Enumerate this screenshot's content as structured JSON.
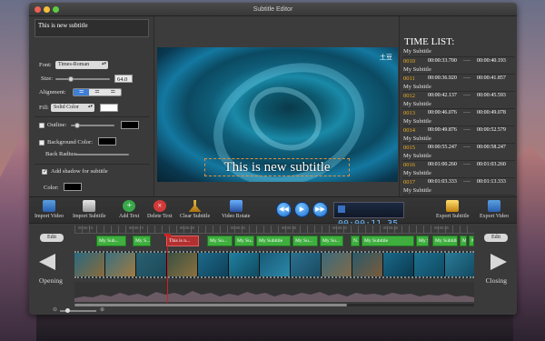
{
  "window": {
    "title": "Subtitle Editor"
  },
  "editor": {
    "subtitle_text": "This  is new subtitle",
    "font_label": "Font:",
    "font_value": "Times-Roman",
    "size_label": "Size:",
    "size_value": "64.0",
    "alignment_label": "Alignment:",
    "fill_label": "Fill:",
    "fill_value": "Solid Color",
    "outline_label": "Outline:",
    "background_label": "Background Color:",
    "back_radius_label": "Back Radius:",
    "shadow_label": "Add shadow for subtitle",
    "color_label": "Color:",
    "colors": {
      "fill_swatch": "#ffffff",
      "outline_swatch": "#000000",
      "background_swatch": "#000000",
      "shadow_swatch": "#000000"
    }
  },
  "video": {
    "watermark": "土豆",
    "subtitle_overlay": "This  is new subtitle"
  },
  "time_list": {
    "title": "TIME LIST:",
    "rows": [
      {
        "index": "",
        "start": "",
        "separator": "",
        "end": "",
        "text": "My Subtitle"
      },
      {
        "index": "0010",
        "start": "00:00:33.700",
        "separator": "----",
        "end": "00:00:40.193",
        "text": "My Subtitle"
      },
      {
        "index": "0011",
        "start": "00:00:36.920",
        "separator": "----",
        "end": "00:00:41.857",
        "text": "My Subtitle"
      },
      {
        "index": "0012",
        "start": "00:00:42.137",
        "separator": "----",
        "end": "00:00:45.593",
        "text": "My Subtitle"
      },
      {
        "index": "0013",
        "start": "00:00:46.076",
        "separator": "----",
        "end": "00:00:49.078",
        "text": "My Subtitle"
      },
      {
        "index": "0014",
        "start": "00:00:49.876",
        "separator": "----",
        "end": "00:00:52.579",
        "text": "My Subtitle"
      },
      {
        "index": "0015",
        "start": "00:00:55.247",
        "separator": "----",
        "end": "00:00:58.247",
        "text": "My Subtitle"
      },
      {
        "index": "0016",
        "start": "00:01:00.260",
        "separator": "----",
        "end": "00:01:03.260",
        "text": "My Subtitle"
      },
      {
        "index": "0017",
        "start": "00:01:03.333",
        "separator": "----",
        "end": "00:01:13.333",
        "text": "My Subtitle"
      }
    ]
  },
  "toolbar": {
    "import_video": "Import Video",
    "import_subtitle": "Import Subtitle",
    "add_text": "Add Text",
    "delete_text": "Delete Text",
    "clear_subtitle": "Clear Subtitle",
    "video_rotate": "Video Rotate",
    "timecode": "00:00:11.35",
    "export_subtitle": "Export Subtitle",
    "export_video": "Export Video",
    "prev_glyph": "◀◀",
    "play_glyph": "▶",
    "next_glyph": "▶▶"
  },
  "timeline": {
    "edit_left": "Edit",
    "edit_right": "Edit",
    "opening_label": "Opening",
    "closing_label": "Closing",
    "ruler_labels": [
      "00:00:10",
      "00:00:15",
      "00:00:20",
      "00:00:25",
      "00:00:30",
      "00:00:35",
      "00:00:40",
      "00:00:45"
    ],
    "clips": [
      "My Sub...",
      "My S...",
      "This  is n...",
      "My Su...",
      "My Su...",
      "My Subtitle",
      "My Su...",
      "My Su...",
      "N...",
      "My Subtitle",
      "My S...",
      "My Subtitle",
      "My S...",
      "M"
    ]
  }
}
